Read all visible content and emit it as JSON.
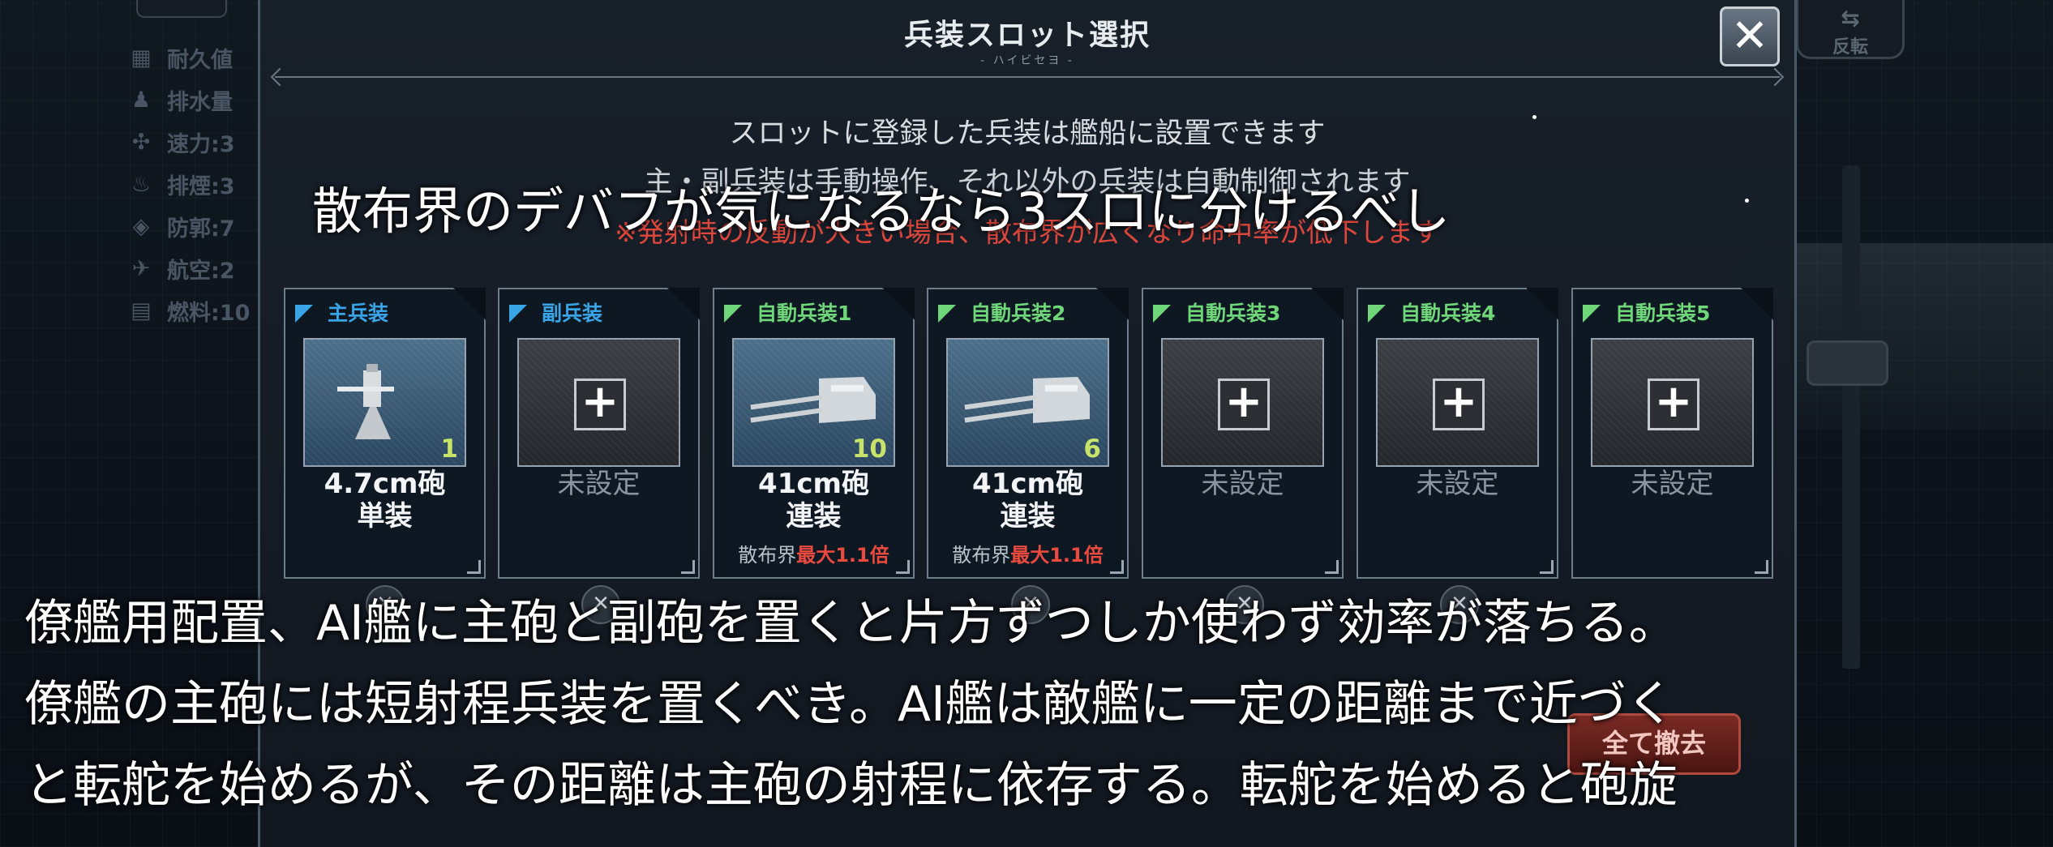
{
  "dialog": {
    "title": "兵装スロット選択",
    "subtitle": "- ハイビセヨ -",
    "info_line1": "スロットに登録した兵装は艦船に設置できます",
    "info_line2": "主・副兵装は手動操作、それ以外の兵装は自動制御されます",
    "warning": "※発射時の反動が大きい場合、散布界が広くなり命中率が低下します",
    "close_label": "✕",
    "remove_all_label": "全て撤去"
  },
  "slots": [
    {
      "header": "主兵装",
      "header_color": "#39a4e6",
      "name_line1": "4.7cm砲",
      "name_line2": "単装",
      "count": "1",
      "dispersion_key": "",
      "dispersion_value": "",
      "empty_label": "",
      "state": "weapon-single"
    },
    {
      "header": "副兵装",
      "header_color": "#39a4e6",
      "name_line1": "",
      "name_line2": "",
      "count": "",
      "dispersion_key": "",
      "dispersion_value": "",
      "empty_label": "未設定",
      "state": "empty"
    },
    {
      "header": "自動兵装1",
      "header_color": "#6fd67a",
      "name_line1": "41cm砲",
      "name_line2": "連装",
      "count": "10",
      "dispersion_key": "散布界",
      "dispersion_value": "最大1.1倍",
      "empty_label": "",
      "state": "weapon-twin"
    },
    {
      "header": "自動兵装2",
      "header_color": "#6fd67a",
      "name_line1": "41cm砲",
      "name_line2": "連装",
      "count": "6",
      "dispersion_key": "散布界",
      "dispersion_value": "最大1.1倍",
      "empty_label": "",
      "state": "weapon-twin"
    },
    {
      "header": "自動兵装3",
      "header_color": "#6fd67a",
      "name_line1": "",
      "name_line2": "",
      "count": "",
      "dispersion_key": "",
      "dispersion_value": "",
      "empty_label": "未設定",
      "state": "empty"
    },
    {
      "header": "自動兵装4",
      "header_color": "#6fd67a",
      "name_line1": "",
      "name_line2": "",
      "count": "",
      "dispersion_key": "",
      "dispersion_value": "",
      "empty_label": "未設定",
      "state": "empty"
    },
    {
      "header": "自動兵装5",
      "header_color": "#6fd67a",
      "name_line1": "",
      "name_line2": "",
      "count": "",
      "dispersion_key": "",
      "dispersion_value": "",
      "empty_label": "未設定",
      "state": "empty"
    }
  ],
  "stats": [
    {
      "icon": "shield-icon",
      "label": "耐久値"
    },
    {
      "icon": "person-icon",
      "label": "排水量"
    },
    {
      "icon": "propeller-icon",
      "label": "速力:3"
    },
    {
      "icon": "smoke-icon",
      "label": "排煙:3"
    },
    {
      "icon": "armor-icon",
      "label": "防郭:7"
    },
    {
      "icon": "plane-icon",
      "label": "航空:2"
    },
    {
      "icon": "fuel-icon",
      "label": "燃料:10"
    }
  ],
  "right_button": {
    "label": "反転",
    "icon": "flip-icon"
  },
  "captions": {
    "top": "散布界のデバフが気になるなら3スロに分けるべし",
    "bottom1": "僚艦用配置、AI艦に主砲と副砲を置くと片方ずつしか使わず効率が落ちる。",
    "bottom2": "僚艦の主砲には短射程兵装を置くべき。AI艦は敵艦に一定の距離まで近づく",
    "bottom3": "と転舵を始めるが、その距離は主砲の射程に依存する。転舵を始めると砲旋"
  }
}
